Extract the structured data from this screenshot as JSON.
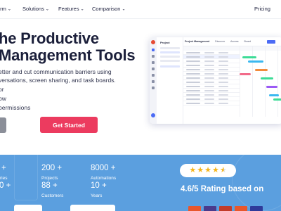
{
  "nav": {
    "items": [
      {
        "label": "orm",
        "has_chevron": true
      },
      {
        "label": "Solutions",
        "has_chevron": true
      },
      {
        "label": "Features",
        "has_chevron": true
      },
      {
        "label": "Comparison",
        "has_chevron": true
      }
    ],
    "pricing": "Pricing"
  },
  "hero": {
    "title_line1": "he Productive",
    "title_line2": "Management Tools",
    "desc_line1": "etter and cut communication barriers using",
    "desc_line2": "versations, screen sharing, and task boards.",
    "features": [
      "or",
      "ow",
      "permissions"
    ],
    "cta_label": "Get Started"
  },
  "mockup": {
    "panel_title": "Project",
    "tabs": [
      "Project Management",
      "Discover",
      "Access",
      "Board"
    ]
  },
  "stats": [
    {
      "value": "+",
      "label": "ries"
    },
    {
      "value": "200 +",
      "label": "Projects"
    },
    {
      "value": "8000 +",
      "label": "Automations"
    },
    {
      "value": "0 +",
      "label": ""
    },
    {
      "value": "88 +",
      "label": "Customers"
    },
    {
      "value": "10 +",
      "label": "Years"
    }
  ],
  "rating": {
    "stars": 4.5,
    "text": "4.6/5 Rating based on"
  },
  "colors": {
    "cta": "#ec3b5f",
    "band": "#5b9fdf",
    "star": "#f5b51b",
    "accent": "#4b6bf5"
  }
}
